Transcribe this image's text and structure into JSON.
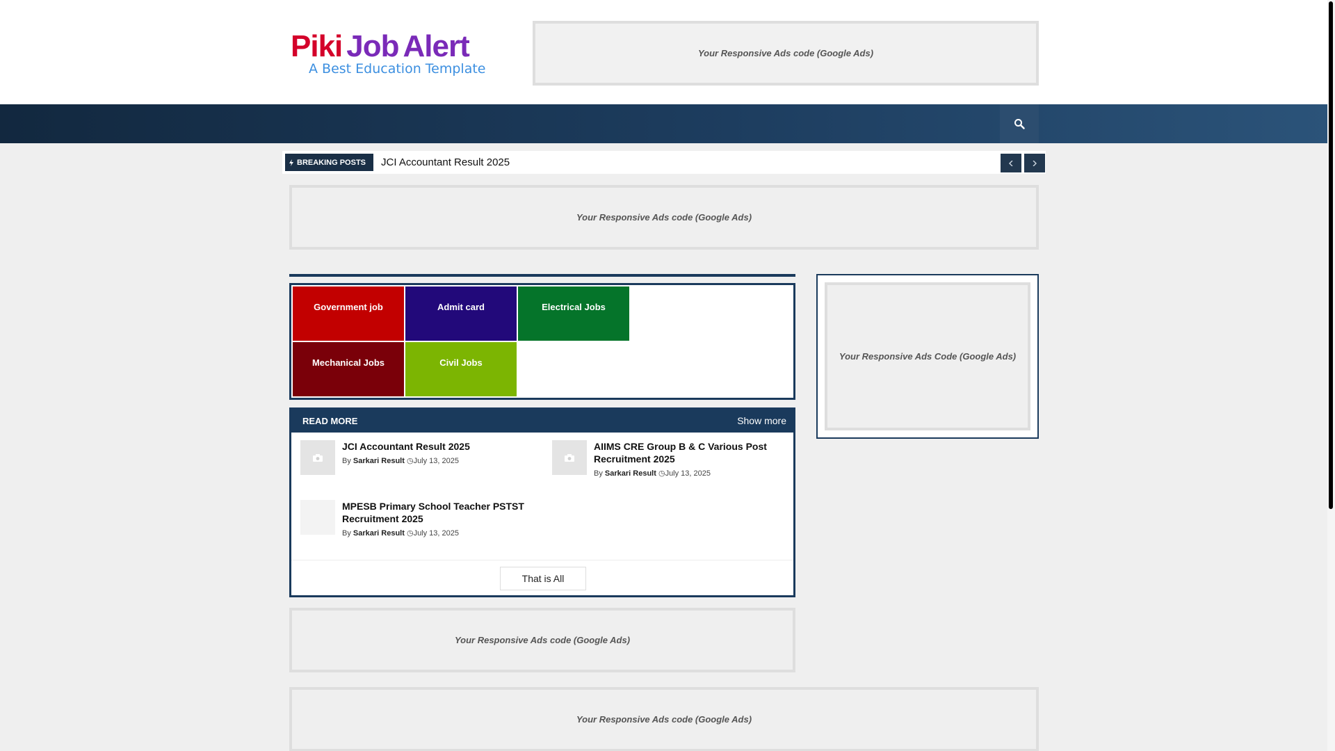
{
  "header": {
    "logo": {
      "part1": "Piki",
      "part2": "Job",
      "part3": "Alert",
      "tagline": "A Best Education Template"
    },
    "ad_text": "Your Responsive Ads code (Google Ads)"
  },
  "nav": {
    "search_icon": "search-icon"
  },
  "breaking": {
    "label": "BREAKING POSTS",
    "headline": "JCI Accountant Result 2025",
    "prev_icon": "prev-icon",
    "next_icon": "next-icon"
  },
  "ads": {
    "top": "Your Responsive Ads code (Google Ads)",
    "sidebar": "Your Responsive Ads Code (Google Ads)",
    "mid": "Your Responsive Ads code (Google Ads)",
    "bottom": "Your Responsive Ads code (Google Ads)"
  },
  "categories": [
    {
      "label": "Government job",
      "color": "#c20000"
    },
    {
      "label": "Admit card",
      "color": "#22097a"
    },
    {
      "label": "Electrical Jobs",
      "color": "#05742a"
    },
    {
      "label": "Mechanical Jobs",
      "color": "#7a0009"
    },
    {
      "label": "Civil Jobs",
      "color": "#7cb502"
    }
  ],
  "read_more": {
    "title": "READ MORE",
    "show_more": "Show more",
    "end_button": "That is All",
    "posts": [
      {
        "title": "JCI Accountant Result 2025",
        "by": "By",
        "author": "Sarkari Result",
        "date": "July 13, 2025"
      },
      {
        "title": "AIIMS CRE Group B & C Various Post Recruitment 2025",
        "by": "By",
        "author": "Sarkari Result",
        "date": "July 13, 2025"
      },
      {
        "title": "MPESB Primary School Teacher PSTST Recruitment 2025",
        "by": "By",
        "author": "Sarkari Result",
        "date": "July 13, 2025"
      }
    ]
  },
  "colors": {
    "primary": "#1a3a5c",
    "nav_dark": "#12283f",
    "nav_light": "#2b5379"
  }
}
